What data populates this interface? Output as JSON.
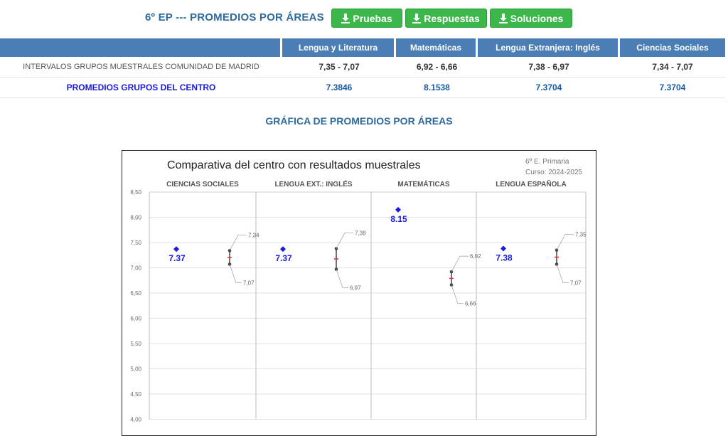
{
  "header": {
    "title": "6º EP --- PROMEDIOS POR ÁREAS",
    "buttons": {
      "pruebas": "Pruebas",
      "respuestas": "Respuestas",
      "soluciones": "Soluciones"
    },
    "button_icon": "download-icon"
  },
  "table": {
    "columns": [
      "Lengua y Literatura",
      "Matemáticas",
      "Lengua Extranjera: Inglés",
      "Ciencias Sociales"
    ],
    "rows": [
      {
        "label": "INTERVALOS GRUPOS MUESTRALES COMUNIDAD DE MADRID",
        "values": [
          "7,35 - 7,07",
          "6,92 - 6,66",
          "7,38 - 6,97",
          "7,34 - 7,07"
        ]
      },
      {
        "label": "PROMEDIOS GRUPOS DEL CENTRO",
        "values": [
          "7.3846",
          "8.1538",
          "7.3704",
          "7.3704"
        ]
      }
    ]
  },
  "chart_heading": "GRÁFICA DE PROMEDIOS POR ÁREAS",
  "colors": {
    "accent": "#2e6a9b",
    "header_bg": "#4a7eb5",
    "button": "#3cb84a",
    "center_point": "#1a1ae0",
    "mid_mark": "#e03030"
  },
  "chart_data": {
    "type": "scatter",
    "title": "Comparativa del centro con resultados muestrales",
    "subtitle_lines": [
      "6º E. Primaria",
      "Curso: 2024-2025"
    ],
    "ylim": [
      4.0,
      8.5
    ],
    "y_ticks": [
      "4,00",
      "4,50",
      "5,00",
      "5,50",
      "6,00",
      "6,50",
      "7,00",
      "7,50",
      "8,00",
      "8,50"
    ],
    "grid": true,
    "panels": [
      {
        "name": "CIENCIAS SOCIALES",
        "center_value": 7.37,
        "center_label": "7.37",
        "upper": 7.34,
        "lower": 7.07,
        "upper_label": "7,34",
        "lower_label": "7,07"
      },
      {
        "name": "LENGUA EXT.: INGLÉS",
        "center_value": 7.37,
        "center_label": "7.37",
        "upper": 7.38,
        "lower": 6.97,
        "upper_label": "7,38",
        "lower_label": "6,97"
      },
      {
        "name": "MATEMÁTICAS",
        "center_value": 8.15,
        "center_label": "8.15",
        "upper": 6.92,
        "lower": 6.66,
        "upper_label": "6,92",
        "lower_label": "6,66"
      },
      {
        "name": "LENGUA ESPAÑOLA",
        "center_value": 7.38,
        "center_label": "7.38",
        "upper": 7.35,
        "lower": 7.07,
        "upper_label": "7,35",
        "lower_label": "7,07"
      }
    ]
  }
}
